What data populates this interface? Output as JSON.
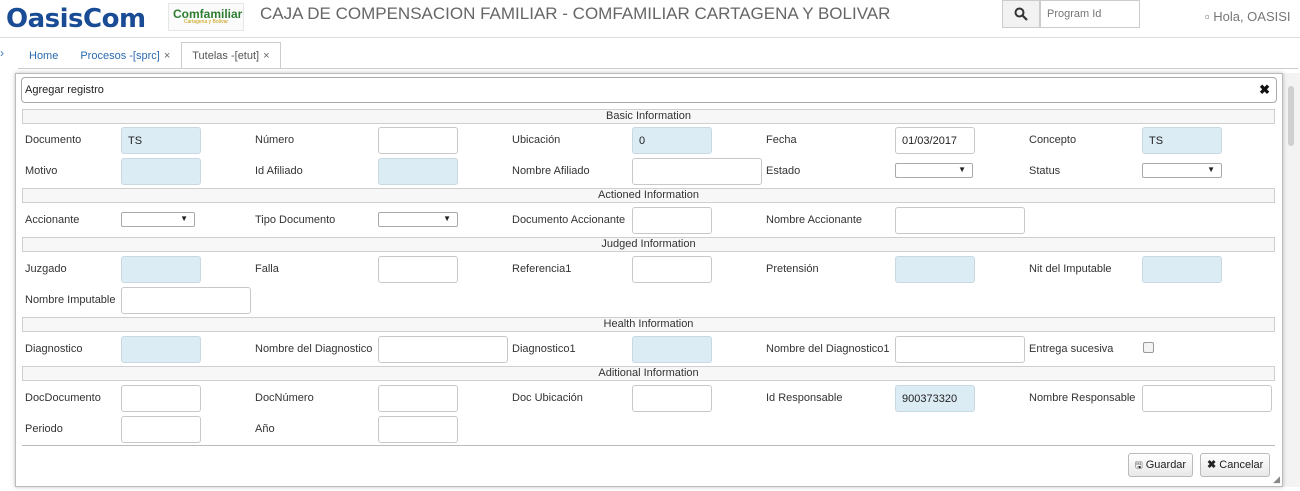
{
  "header": {
    "logo_text": "OasisCom",
    "partner_logo": "Comfamiliar",
    "partner_logo_sub": "Cartagena y Bolívar",
    "title": "CAJA DE COMPENSACION FAMILIAR - COMFAMILIAR CARTAGENA Y BOLIVAR",
    "search_placeholder": "Program Id",
    "greeting": "▫ Hola, OASISI"
  },
  "tabs": [
    {
      "label": "Home",
      "closable": false,
      "active": false
    },
    {
      "label": "Procesos -[sprc]",
      "closable": true,
      "active": false
    },
    {
      "label": "Tutelas -[etut]",
      "closable": true,
      "active": true
    }
  ],
  "modal": {
    "title": "Agregar registro",
    "sections": {
      "basic": "Basic Information",
      "actioned": "Actioned Information",
      "judged": "Judged Information",
      "health": "Health Information",
      "aditional": "Aditional Information"
    },
    "fields": {
      "documento": {
        "label": "Documento",
        "value": "TS"
      },
      "numero": {
        "label": "Número",
        "value": ""
      },
      "ubicacion": {
        "label": "Ubicación",
        "value": "0"
      },
      "fecha": {
        "label": "Fecha",
        "value": "01/03/2017"
      },
      "concepto": {
        "label": "Concepto",
        "value": "TS"
      },
      "motivo": {
        "label": "Motivo",
        "value": ""
      },
      "id_afiliado": {
        "label": "Id Afiliado",
        "value": ""
      },
      "nombre_afiliado": {
        "label": "Nombre Afiliado",
        "value": ""
      },
      "estado": {
        "label": "Estado",
        "value": ""
      },
      "status": {
        "label": "Status",
        "value": ""
      },
      "accionante": {
        "label": "Accionante",
        "value": ""
      },
      "tipo_documento": {
        "label": "Tipo Documento",
        "value": ""
      },
      "documento_accionante": {
        "label": "Documento Accionante",
        "value": ""
      },
      "nombre_accionante": {
        "label": "Nombre Accionante",
        "value": ""
      },
      "juzgado": {
        "label": "Juzgado",
        "value": ""
      },
      "falla": {
        "label": "Falla",
        "value": ""
      },
      "referencia1": {
        "label": "Referencia1",
        "value": ""
      },
      "pretension": {
        "label": "Pretensión",
        "value": ""
      },
      "nit_imputable": {
        "label": "Nit del Imputable",
        "value": ""
      },
      "nombre_imputable": {
        "label": "Nombre Imputable",
        "value": ""
      },
      "diagnostico": {
        "label": "Diagnostico",
        "value": ""
      },
      "nombre_diagnostico": {
        "label": "Nombre del Diagnostico",
        "value": ""
      },
      "diagnostico1": {
        "label": "Diagnostico1",
        "value": ""
      },
      "nombre_diagnostico1": {
        "label": "Nombre del Diagnostico1",
        "value": ""
      },
      "entrega_sucesiva": {
        "label": "Entrega sucesiva",
        "checked": false
      },
      "doc_documento": {
        "label": "DocDocumento",
        "value": ""
      },
      "doc_numero": {
        "label": "DocNúmero",
        "value": ""
      },
      "doc_ubicacion": {
        "label": "Doc Ubicación",
        "value": ""
      },
      "id_responsable": {
        "label": "Id Responsable",
        "value": "900373320"
      },
      "nombre_responsable": {
        "label": "Nombre Responsable",
        "value": ""
      },
      "periodo": {
        "label": "Periodo",
        "value": ""
      },
      "anio": {
        "label": "Año",
        "value": ""
      }
    },
    "buttons": {
      "save": "Guardar",
      "cancel": "Cancelar"
    }
  },
  "colors": {
    "readonly_field": "#dcecf5",
    "link": "#2a6bb0",
    "logo": "#1a4c95"
  }
}
